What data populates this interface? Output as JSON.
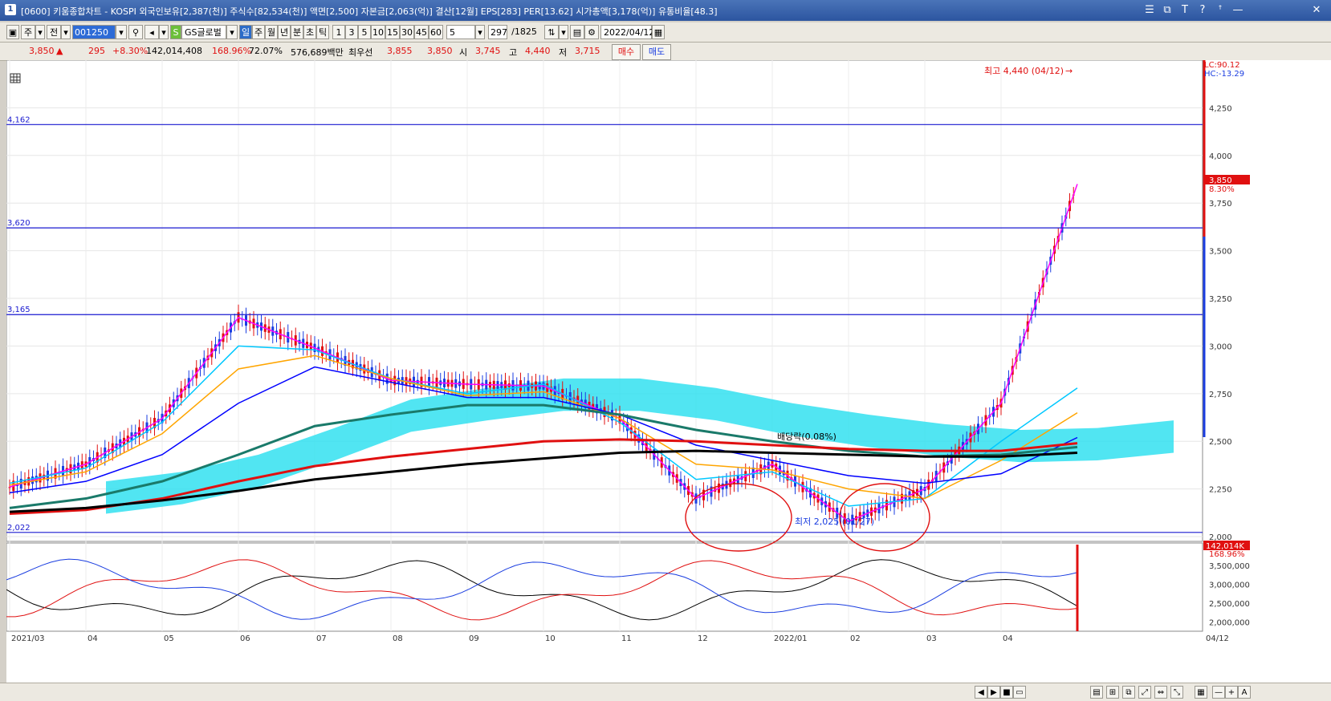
{
  "window": {
    "icon": "1",
    "title": "[0600] 키움종합차트 - KOSPI 외국인보유[2,387(천)] 주식수[82,534(천)] 액면[2,500] 자본금[2,063(억)] 결산[12월] EPS[283] PER[13.62] 시가총액[3,178(억)] 유통비율[48.3]",
    "controls": [
      "☰",
      "⧉",
      "T",
      "?",
      "ꜛ",
      "—",
      "□",
      "✕"
    ]
  },
  "toolbar": {
    "mode": "주",
    "prev": "전",
    "code": "001250",
    "group": "GS글로벌",
    "periods": [
      "일",
      "주",
      "월",
      "년",
      "분",
      "초",
      "틱"
    ],
    "active_period": "일",
    "intervals": [
      "1",
      "3",
      "5",
      "10",
      "15",
      "30",
      "45",
      "60"
    ],
    "interval_value": "5",
    "count": "297",
    "count_total": "/1825",
    "date": "2022/04/12"
  },
  "quote": {
    "price": "3,850",
    "change_arrow": "▲",
    "change": "295",
    "change_pct": "+8.30%",
    "volume": "142,014,408",
    "volume_ratio": "168.96%",
    "turnover": "72.07%",
    "amount": "576,689백만",
    "best_label": "최우선",
    "best_ask": "3,855",
    "best_bid": "3,850",
    "open_label": "시",
    "open": "3,745",
    "high_label": "고",
    "high": "4,440",
    "low_label": "저",
    "low": "3,715",
    "buy_label": "매수",
    "sell_label": "매도"
  },
  "chart": {
    "lc_label": "LC:90.12",
    "hc_label": "HC:-13.29",
    "current_price_label": "3,850",
    "current_pct_label": "8.30%",
    "high_annotation": "최고 4,440 (04/12)",
    "low_annotation": "최저 2,025 (01/27)",
    "dividend_annotation": "배당락(0.08%)",
    "volume_label": "142,014K",
    "volume_pct_label": "168.96%",
    "x_labels": [
      "2021/03",
      "04",
      "05",
      "06",
      "07",
      "08",
      "09",
      "10",
      "11",
      "12",
      "2022/01",
      "02",
      "03",
      "04",
      "04/12"
    ],
    "hlines": [
      {
        "value": 4162,
        "label": "4,162"
      },
      {
        "value": 3620,
        "label": "3,620"
      },
      {
        "value": 3165,
        "label": "3,165"
      },
      {
        "value": 2022,
        "label": "2,022"
      }
    ]
  },
  "chart_data": [
    {
      "type": "line",
      "title": "",
      "y_ticks": [
        2000,
        2250,
        2500,
        2750,
        3000,
        3250,
        3500,
        3750,
        4000,
        4250
      ],
      "ylim": [
        1975,
        4500
      ],
      "x": [
        "2021/03",
        "04",
        "05",
        "06",
        "07",
        "08",
        "09",
        "10",
        "11",
        "12",
        "2022/01",
        "02",
        "03",
        "04",
        "04/12"
      ],
      "series": [
        {
          "values": [
            2260,
            2380,
            2620,
            3150,
            2990,
            2820,
            2800,
            2790,
            2620,
            2200,
            2380,
            2080,
            2250,
            2700,
            3850
          ]
        },
        {
          "values": [
            2280,
            2360,
            2600,
            3000,
            2980,
            2830,
            2750,
            2800,
            2600,
            2300,
            2340,
            2160,
            2200,
            2500,
            2780
          ]
        },
        {
          "values": [
            2270,
            2340,
            2540,
            2880,
            2950,
            2830,
            2740,
            2760,
            2620,
            2380,
            2350,
            2250,
            2200,
            2400,
            2650
          ]
        },
        {
          "values": [
            2230,
            2290,
            2430,
            2700,
            2890,
            2810,
            2730,
            2730,
            2640,
            2480,
            2400,
            2320,
            2280,
            2330,
            2520
          ]
        },
        {
          "values": [
            2150,
            2200,
            2290,
            2430,
            2580,
            2640,
            2690,
            2690,
            2640,
            2560,
            2500,
            2450,
            2420,
            2430,
            2470
          ]
        },
        {
          "values": [
            2120,
            2140,
            2200,
            2290,
            2370,
            2420,
            2460,
            2500,
            2510,
            2500,
            2480,
            2460,
            2450,
            2450,
            2490
          ]
        },
        {
          "values": [
            2130,
            2150,
            2190,
            2240,
            2300,
            2340,
            2380,
            2410,
            2440,
            2450,
            2440,
            2430,
            2420,
            2420,
            2440
          ]
        }
      ],
      "ichimoku_cloud": {
        "band": "cyan"
      },
      "colors": {
        "up": "#e01010",
        "down": "#1a3de0",
        "ma": [
          "#ff00ff",
          "#00c8ff",
          "#ffa500",
          "#0000ff",
          "#1a7a6a",
          "#e01010",
          "#000000"
        ]
      }
    },
    {
      "type": "line",
      "title": "",
      "y_ticks": [
        2000000,
        2500000,
        3000000,
        3500000
      ],
      "y_tick_labels": [
        "2,000,000",
        "2,500,000",
        "3,000,000",
        "3,500,000"
      ],
      "ylim": [
        1750000,
        4100000
      ]
    }
  ],
  "statusbar": {
    "buttons": [
      "◀",
      "▶",
      "■",
      "▭",
      "▤",
      "⊞",
      "⧉",
      "⤢",
      "⇔",
      "⤡",
      "▦",
      "—",
      "+",
      "A"
    ]
  }
}
